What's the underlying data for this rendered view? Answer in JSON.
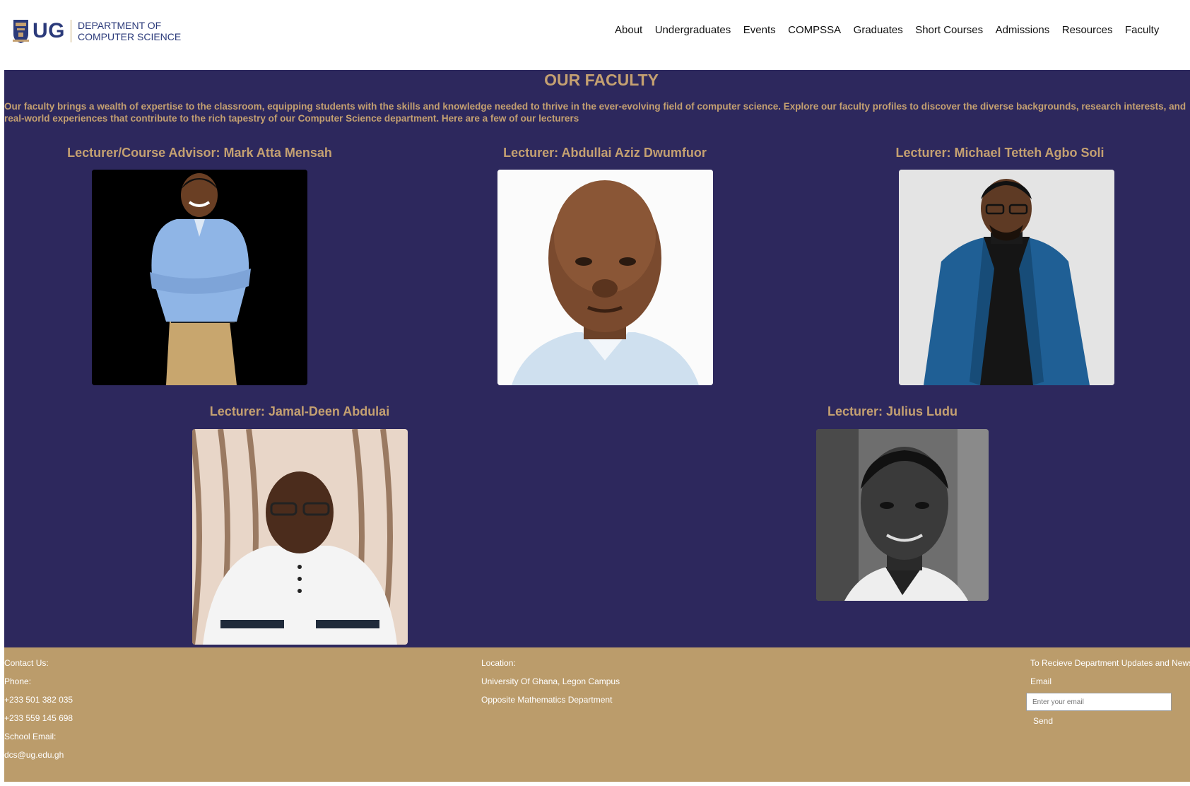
{
  "header": {
    "logo_text": "UG",
    "dept_line1": "DEPARTMENT OF",
    "dept_line2": "COMPUTER SCIENCE",
    "nav": [
      "About",
      "Undergraduates",
      "Events",
      "COMPSSA",
      "Graduates",
      "Short Courses",
      "Admissions",
      "Resources",
      "Faculty"
    ]
  },
  "main": {
    "title": "OUR FACULTY",
    "intro": "Our faculty brings a wealth of expertise to the classroom, equipping students with the skills and knowledge needed to thrive in the ever-evolving field of computer science. Explore our faculty profiles to discover the diverse backgrounds, research interests, and real-world experiences that contribute to the rich tapestry of our Computer Science department. Here are a few of our lecturers",
    "faculty": [
      {
        "name": "Lecturer/Course Advisor: Mark Atta Mensah"
      },
      {
        "name": "Lecturer: Abdullai Aziz Dwumfuor"
      },
      {
        "name": "Lecturer: Michael Tetteh Agbo Soli"
      },
      {
        "name": "Lecturer: Jamal-Deen Abdulai"
      },
      {
        "name": "Lecturer: Julius Ludu"
      }
    ]
  },
  "footer": {
    "contact": {
      "heading": "Contact Us:",
      "phone_label": "Phone:",
      "phone1": "+233 501 382 035",
      "phone2": "+233 559 145 698",
      "email_label": "School Email:",
      "email": "dcs@ug.edu.gh"
    },
    "location": {
      "heading": "Location:",
      "line1": "University Of Ghana, Legon Campus",
      "line2": "Opposite Mathematics Department"
    },
    "newsletter": {
      "heading": "To Recieve Department Updates and News",
      "email_label": "Email",
      "placeholder": "Enter your email",
      "send": "Send"
    }
  },
  "colors": {
    "primary": "#2d285d",
    "accent": "#c4a071",
    "footer": "#bb9c6b"
  }
}
